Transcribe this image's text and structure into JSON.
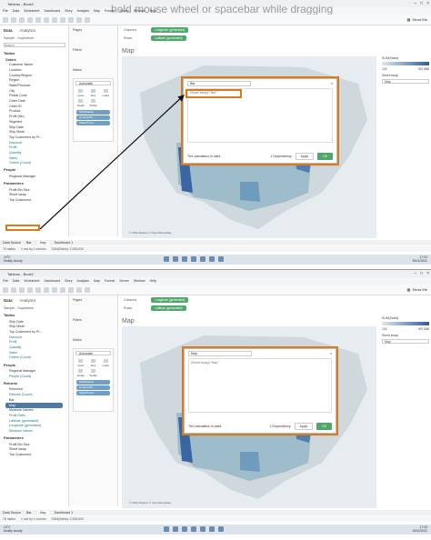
{
  "overlay_hint": "hold mouse wheel or spacebar while dragging",
  "panes": [
    {
      "window_title": "Tableau - Book2",
      "menu": [
        "File",
        "Data",
        "Worksheet",
        "Dashboard",
        "Story",
        "Analysis",
        "Map",
        "Format",
        "Server",
        "Window",
        "Help"
      ],
      "data_tab": "Data",
      "analytics_tab": "Analytics",
      "source": "Sample - Superstore",
      "search_placeholder": "Search",
      "tables_label": "Tables",
      "orders_label": "Orders",
      "fields": [
        "Customer Name",
        "Location",
        "Country/Region",
        "Region",
        "State/Province",
        "City",
        "Postal Code",
        "Order Date",
        "Order ID",
        "Product",
        "Profit (bin)",
        "Segment",
        "Ship Date",
        "Ship Mode",
        "Top Customers by Pr...",
        "Discount",
        "Profit",
        "Quantity",
        "Sales",
        "Orders (Count)"
      ],
      "people_label": "People",
      "people_fields": [
        "Regional Manager"
      ],
      "parameters_label": "Parameters",
      "param_fields": [
        "Profit Bin Size",
        "Sheet swap",
        "Top Customers"
      ],
      "pages_label": "Pages",
      "filters_label": "Filters",
      "marks_label": "Marks",
      "marks_type": "Automatic",
      "mark_cells": [
        "Color",
        "Size",
        "Label",
        "Detail",
        "Tooltip"
      ],
      "mark_pills": [
        "SUM(Sales)",
        "Country/Re...",
        "State/Provin..."
      ],
      "columns_label": "Columns",
      "rows_label": "Rows",
      "columns_pill": "Longitude (generated)",
      "rows_pill": "Latitude (generated)",
      "view_title": "Map",
      "legend_title": "SUM(Sales)",
      "legend_min": "132",
      "legend_max": "457,688",
      "legend_param": "Sheet swap",
      "legend_value": "Map",
      "calc_name": "Bar",
      "calc_formula": "[Sheet swap]=\"Bar\"",
      "calc_valid": "The calculation is valid.",
      "dependency": "1 Dependency",
      "apply_label": "Apply",
      "ok_label": "OK",
      "copyright": "© 2022 Mapbox © OpenStreetMap",
      "sheet_tabs": [
        "Data Source",
        "Bar",
        "Map",
        "Dashboard 1"
      ],
      "status": [
        "78 marks",
        "1 row by 1 column",
        "SUM(Sales): 2,326,534"
      ],
      "weather_temp": "14°C",
      "weather_desc": "Mostly cloudy",
      "lang": "ENG\nUK",
      "time": "17:03",
      "date": "15/11/2022"
    },
    {
      "window_title": "Tableau - Book2",
      "menu": [
        "File",
        "Data",
        "Worksheet",
        "Dashboard",
        "Story",
        "Analysis",
        "Map",
        "Format",
        "Server",
        "Window",
        "Help"
      ],
      "data_tab": "Data",
      "analytics_tab": "Analytics",
      "source": "Sample - Superstore",
      "tables_label": "Tables",
      "fields": [
        "Ship Date",
        "Ship Mode",
        "Top Customers by Pr...",
        "Discount",
        "Profit",
        "Quantity",
        "Sales",
        "Orders (Count)"
      ],
      "people_label": "People",
      "people_fields": [
        "Regional Manager",
        "People (Count)"
      ],
      "returns_label": "Returns",
      "returns_fields": [
        "Returned",
        "Returns (Count)"
      ],
      "calc_fields": [
        "Bar",
        "Map",
        "Measure Names",
        "Profit Ratio",
        "Latitude (generated)",
        "Longitude (generated)",
        "Measure Values"
      ],
      "parameters_label": "Parameters",
      "param_fields": [
        "Profit Bin Size",
        "Sheet swap",
        "Top Customers"
      ],
      "pages_label": "Pages",
      "filters_label": "Filters",
      "marks_label": "Marks",
      "marks_type": "Automatic",
      "mark_cells": [
        "Color",
        "Size",
        "Label",
        "Detail",
        "Tooltip"
      ],
      "mark_pills": [
        "SUM(Sales)",
        "Country/Re...",
        "State/Provin..."
      ],
      "columns_label": "Columns",
      "rows_label": "Rows",
      "columns_pill": "Longitude (generated)",
      "rows_pill": "Latitude (generated)",
      "view_title": "Map",
      "legend_title": "SUM(Sales)",
      "legend_min": "132",
      "legend_max": "457,688",
      "legend_param": "Sheet swap",
      "legend_value": "Map",
      "calc_name": "Map",
      "calc_formula": "[Sheet swap]=\"Map\"",
      "calc_valid": "The calculation is valid.",
      "dependency": "1 Dependency",
      "apply_label": "Apply",
      "ok_label": "OK",
      "copyright": "© 2022 Mapbox © OpenStreetMap",
      "sheet_tabs": [
        "Data Source",
        "Bar",
        "Map",
        "Dashboard 1"
      ],
      "status": [
        "78 marks",
        "1 row by 1 column",
        "SUM(Sales): 2,326,534"
      ],
      "weather_temp": "14°C",
      "weather_desc": "Mostly cloudy",
      "lang": "ENG\nUK",
      "time": "17:03",
      "date": "15/11/2022"
    }
  ],
  "colors": {
    "accent_orange": "#d97a1c",
    "pill_green": "#4ea86a",
    "pill_blue": "#6f9fc6"
  }
}
